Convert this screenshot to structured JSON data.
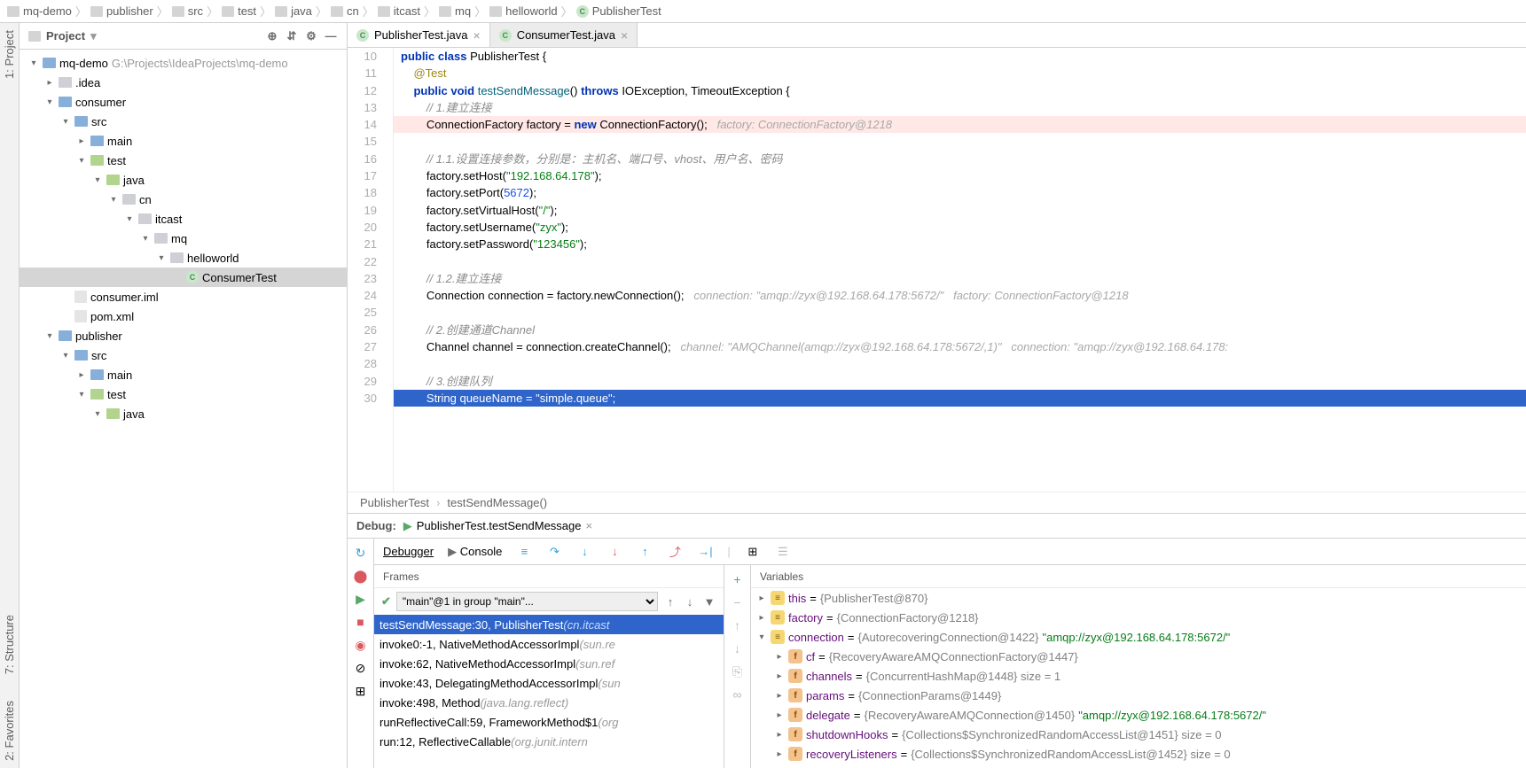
{
  "breadcrumb": [
    "mq-demo",
    "publisher",
    "src",
    "test",
    "java",
    "cn",
    "itcast",
    "mq",
    "helloworld",
    "PublisherTest"
  ],
  "left_stripe": {
    "project": "1: Project",
    "structure": "7: Structure",
    "favorites": "2: Favorites"
  },
  "project": {
    "header": "Project",
    "root": {
      "name": "mq-demo",
      "path": "G:\\Projects\\IdeaProjects\\mq-demo"
    },
    "tree": [
      {
        "depth": 0,
        "caret": "▾",
        "ico": "mod",
        "label": "mq-demo",
        "path": "G:\\Projects\\IdeaProjects\\mq-demo"
      },
      {
        "depth": 1,
        "caret": "▸",
        "ico": "dir",
        "label": ".idea"
      },
      {
        "depth": 1,
        "caret": "▾",
        "ico": "mod",
        "label": "consumer"
      },
      {
        "depth": 2,
        "caret": "▾",
        "ico": "mod",
        "label": "src"
      },
      {
        "depth": 3,
        "caret": "▸",
        "ico": "mod",
        "label": "main"
      },
      {
        "depth": 3,
        "caret": "▾",
        "ico": "test",
        "label": "test"
      },
      {
        "depth": 4,
        "caret": "▾",
        "ico": "test",
        "label": "java"
      },
      {
        "depth": 5,
        "caret": "▾",
        "ico": "dir",
        "label": "cn"
      },
      {
        "depth": 6,
        "caret": "▾",
        "ico": "dir",
        "label": "itcast"
      },
      {
        "depth": 7,
        "caret": "▾",
        "ico": "dir",
        "label": "mq"
      },
      {
        "depth": 8,
        "caret": "▾",
        "ico": "dir",
        "label": "helloworld"
      },
      {
        "depth": 9,
        "caret": "",
        "ico": "class",
        "label": "ConsumerTest",
        "selected": true
      },
      {
        "depth": 2,
        "caret": "",
        "ico": "file",
        "label": "consumer.iml"
      },
      {
        "depth": 2,
        "caret": "",
        "ico": "file",
        "label": "pom.xml"
      },
      {
        "depth": 1,
        "caret": "▾",
        "ico": "mod",
        "label": "publisher"
      },
      {
        "depth": 2,
        "caret": "▾",
        "ico": "mod",
        "label": "src"
      },
      {
        "depth": 3,
        "caret": "▸",
        "ico": "mod",
        "label": "main"
      },
      {
        "depth": 3,
        "caret": "▾",
        "ico": "test",
        "label": "test"
      },
      {
        "depth": 4,
        "caret": "▾",
        "ico": "test",
        "label": "java"
      }
    ]
  },
  "editor": {
    "tabs": [
      {
        "label": "PublisherTest.java",
        "active": true
      },
      {
        "label": "ConsumerTest.java",
        "active": false
      }
    ],
    "breadcrumb_mini": [
      "PublisherTest",
      "testSendMessage()"
    ],
    "first_line_no": 10,
    "breakpoint_line": 14,
    "exec_line": 30,
    "run_markers": [
      10,
      12
    ],
    "lines": [
      {
        "n": 10,
        "html": "<span class='kw'>public</span> <span class='kw'>class</span> <span class='cls'>PublisherTest</span> {"
      },
      {
        "n": 11,
        "html": "    <span class='ann'>@Test</span>"
      },
      {
        "n": 12,
        "html": "    <span class='kw'>public</span> <span class='kw'>void</span> <span class='mth'>testSendMessage</span>() <span class='kw'>throws</span> IOException, TimeoutException {"
      },
      {
        "n": 13,
        "html": "        <span class='cm'>// 1.建立连接</span>"
      },
      {
        "n": 14,
        "html": "        ConnectionFactory factory = <span class='kw'>new</span> ConnectionFactory();   <span class='hint'>factory: ConnectionFactory@1218</span>"
      },
      {
        "n": 15,
        "html": ""
      },
      {
        "n": 16,
        "html": "        <span class='cm'>// 1.1.设置连接参数，分别是：主机名、端口号、vhost、用户名、密码</span>"
      },
      {
        "n": 17,
        "html": "        factory.setHost(<span class='str'>\"192.168.64.178\"</span>);"
      },
      {
        "n": 18,
        "html": "        factory.setPort(<span class='num'>5672</span>);"
      },
      {
        "n": 19,
        "html": "        factory.setVirtualHost(<span class='str'>\"/\"</span>);"
      },
      {
        "n": 20,
        "html": "        factory.setUsername(<span class='str'>\"zyx\"</span>);"
      },
      {
        "n": 21,
        "html": "        factory.setPassword(<span class='str'>\"123456\"</span>);"
      },
      {
        "n": 22,
        "html": ""
      },
      {
        "n": 23,
        "html": "        <span class='cm'>// 1.2.建立连接</span>"
      },
      {
        "n": 24,
        "html": "        Connection connection = factory.newConnection();   <span class='hint'>connection: \"amqp://zyx@192.168.64.178:5672/\"   factory: ConnectionFactory@1218</span>"
      },
      {
        "n": 25,
        "html": ""
      },
      {
        "n": 26,
        "html": "        <span class='cm'>// 2.创建通道Channel</span>"
      },
      {
        "n": 27,
        "html": "        Channel channel = connection.createChannel();   <span class='hint'>channel: \"AMQChannel(amqp://zyx@192.168.64.178:5672/,1)\"   connection: \"amqp://zyx@192.168.64.178:</span>"
      },
      {
        "n": 28,
        "html": ""
      },
      {
        "n": 29,
        "html": "        <span class='cm'>// 3.创建队列</span>"
      },
      {
        "n": 30,
        "html": "        String queueName = <span class='str'>\"simple.queue\"</span>;"
      }
    ]
  },
  "debug": {
    "title": "Debug:",
    "tab_label": "PublisherTest.testSendMessage",
    "sub_tabs": {
      "debugger": "Debugger",
      "console": "Console"
    },
    "frames_head": "Frames",
    "vars_head": "Variables",
    "thread_dd": "\"main\"@1 in group \"main\"...",
    "frames": [
      {
        "loc": "testSendMessage:30, PublisherTest",
        "pkg": "(cn.itcast",
        "sel": true
      },
      {
        "loc": "invoke0:-1, NativeMethodAccessorImpl",
        "pkg": "(sun.re"
      },
      {
        "loc": "invoke:62, NativeMethodAccessorImpl",
        "pkg": "(sun.ref"
      },
      {
        "loc": "invoke:43, DelegatingMethodAccessorImpl",
        "pkg": "(sun"
      },
      {
        "loc": "invoke:498, Method",
        "pkg": "(java.lang.reflect)"
      },
      {
        "loc": "runReflectiveCall:59, FrameworkMethod$1",
        "pkg": "(org"
      },
      {
        "loc": "run:12, ReflectiveCallable",
        "pkg": "(org.junit.intern"
      }
    ],
    "vars": [
      {
        "d": 0,
        "c": "▸",
        "k": "obj",
        "name": "this",
        "val": "{PublisherTest@870}"
      },
      {
        "d": 0,
        "c": "▸",
        "k": "obj",
        "name": "factory",
        "val": "{ConnectionFactory@1218}"
      },
      {
        "d": 0,
        "c": "▾",
        "k": "obj",
        "name": "connection",
        "val": "{AutorecoveringConnection@1422}",
        "str": "\"amqp://zyx@192.168.64.178:5672/\""
      },
      {
        "d": 1,
        "c": "▸",
        "k": "fld",
        "name": "cf",
        "val": "{RecoveryAwareAMQConnectionFactory@1447}"
      },
      {
        "d": 1,
        "c": "▸",
        "k": "fld",
        "name": "channels",
        "val": "{ConcurrentHashMap@1448}  size = 1"
      },
      {
        "d": 1,
        "c": "▸",
        "k": "fld",
        "name": "params",
        "val": "{ConnectionParams@1449}"
      },
      {
        "d": 1,
        "c": "▸",
        "k": "fld",
        "name": "delegate",
        "val": "{RecoveryAwareAMQConnection@1450}",
        "str": "\"amqp://zyx@192.168.64.178:5672/\""
      },
      {
        "d": 1,
        "c": "▸",
        "k": "fld",
        "name": "shutdownHooks",
        "val": "{Collections$SynchronizedRandomAccessList@1451}  size = 0"
      },
      {
        "d": 1,
        "c": "▸",
        "k": "fld",
        "name": "recoveryListeners",
        "val": "{Collections$SynchronizedRandomAccessList@1452}  size = 0"
      }
    ]
  }
}
